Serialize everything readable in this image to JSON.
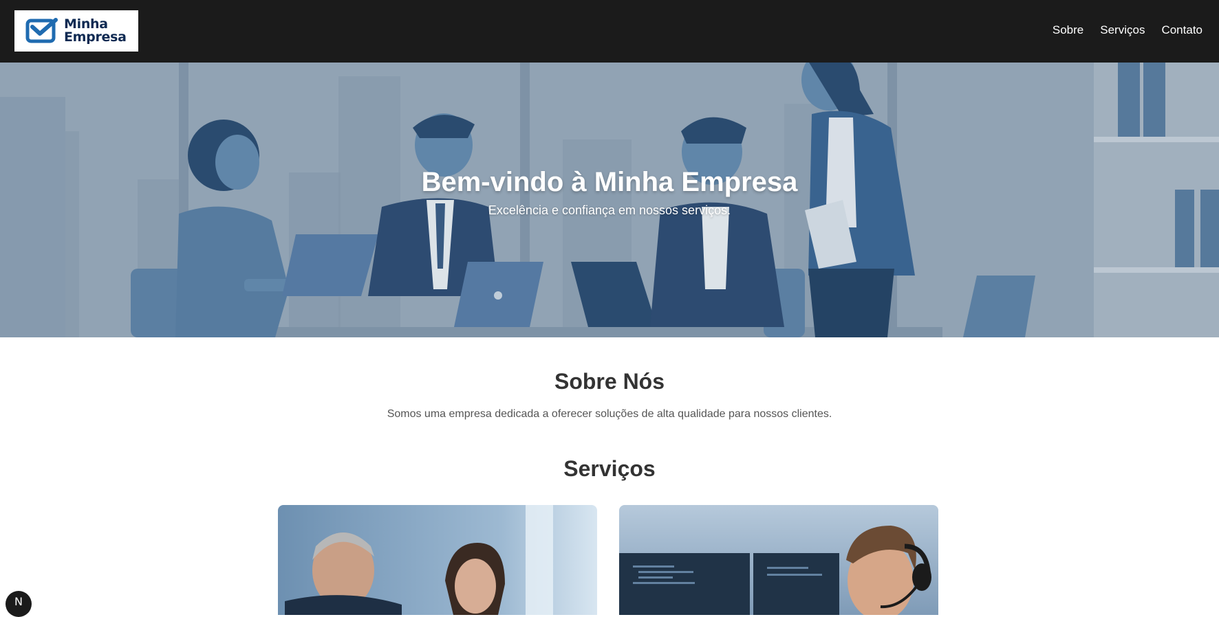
{
  "brand": {
    "name_line1": "Minha",
    "name_line2": "Empresa",
    "color": "#0f2a52",
    "accent": "#1f6bb0"
  },
  "nav": {
    "links": [
      {
        "label": "Sobre",
        "icon": null
      },
      {
        "label": "Serviços",
        "icon": null
      },
      {
        "label": "Contato",
        "icon": null
      }
    ],
    "background": "#1b1b1b"
  },
  "hero": {
    "title": "Bem-vindo à Minha Empresa",
    "subtitle": "Excelência e confiança em nossos serviços.",
    "image": "office-meeting-illustration"
  },
  "about": {
    "title": "Sobre Nós",
    "text": "Somos uma empresa dedicada a oferecer soluções de alta qualidade para nossos clientes."
  },
  "services": {
    "title": "Serviços",
    "cards": [
      {
        "image": "business-consulting-photo"
      },
      {
        "image": "tech-support-photo"
      }
    ]
  },
  "floating_badge": {
    "label": "N",
    "icon": "next-logo-icon"
  }
}
